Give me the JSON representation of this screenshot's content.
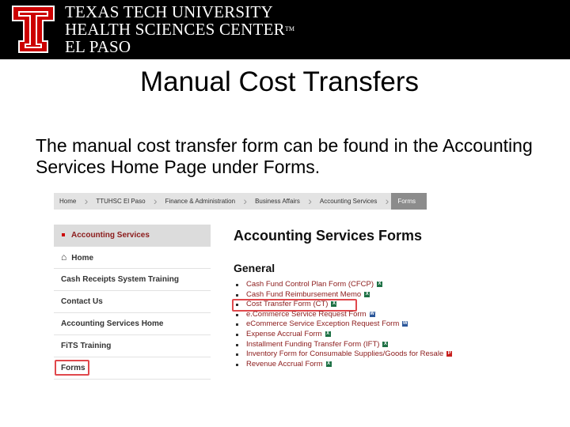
{
  "banner": {
    "line1": "TEXAS TECH UNIVERSITY",
    "line2": "HEALTH SCIENCES CENTER",
    "trademark": "TM",
    "line3": "EL PASO"
  },
  "slide": {
    "title": "Manual Cost Transfers",
    "body": "The manual cost transfer form can be found in the Accounting Services Home Page under Forms."
  },
  "breadcrumb": [
    "Home",
    "TTUHSC El Paso",
    "Finance & Administration",
    "Business Affairs",
    "Accounting Services",
    "Forms"
  ],
  "sidebar": {
    "heading": "Accounting Services",
    "items": [
      "Home",
      "Cash Receipts System Training",
      "Contact Us",
      "Accounting Services Home",
      "FiTS Training",
      "Forms"
    ]
  },
  "main": {
    "title": "Accounting Services Forms",
    "section": "General",
    "links": [
      {
        "label": "Cash Fund Control Plan Form (CFCP)",
        "badge": "X"
      },
      {
        "label": "Cash Fund Reimbursement Memo",
        "badge": "X"
      },
      {
        "label": "Cost Transfer Form (CT)",
        "badge": "X"
      },
      {
        "label": "e.Commerce Service Request Form",
        "badge": "W"
      },
      {
        "label": "eCommerce Service Exception Request Form",
        "badge": "W"
      },
      {
        "label": "Expense Accrual Form",
        "badge": "X"
      },
      {
        "label": "Installment Funding Transfer Form (IFT)",
        "badge": "X"
      },
      {
        "label": "Inventory Form for Consumable Supplies/Goods for Resale",
        "badge": "P"
      },
      {
        "label": "Revenue Accrual Form",
        "badge": "X"
      }
    ]
  },
  "colors": {
    "banner_bg": "#000000",
    "logo_red": "#cc0000",
    "link_maroon": "#8b1a1a",
    "highlight_red": "#e0484c",
    "excel_green": "#1e7145",
    "word_blue": "#2b579a",
    "pdf_red": "#c8201e"
  }
}
